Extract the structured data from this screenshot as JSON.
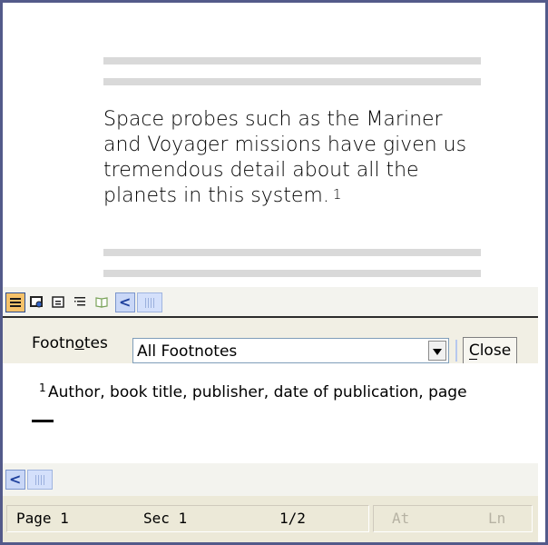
{
  "document": {
    "body_text": "Space probes such as the Mariner and Voyager missions have given us tremendous detail about all the planets in this system.",
    "footnote_ref": "1"
  },
  "view_toolbar": {
    "buttons": [
      "normal-view",
      "web-layout-view",
      "print-layout-view",
      "outline-view",
      "reading-layout-view"
    ],
    "scroll_left_glyph": "<"
  },
  "footnotes_pane": {
    "label": "Footnotes",
    "label_accel_char": "o",
    "select_value": "All Footnotes",
    "close_label": "Close",
    "footnote_number": "1",
    "footnote_text": "Author, book title, publisher, date of publication, page"
  },
  "status_bar": {
    "page": "Page 1",
    "section": "Sec 1",
    "page_count": "1/2",
    "at": "At",
    "ln": "Ln"
  },
  "colors": {
    "window_border": "#535a8a",
    "active_button": "#f6c26a",
    "status_bar_bg": "#ece9d8"
  }
}
